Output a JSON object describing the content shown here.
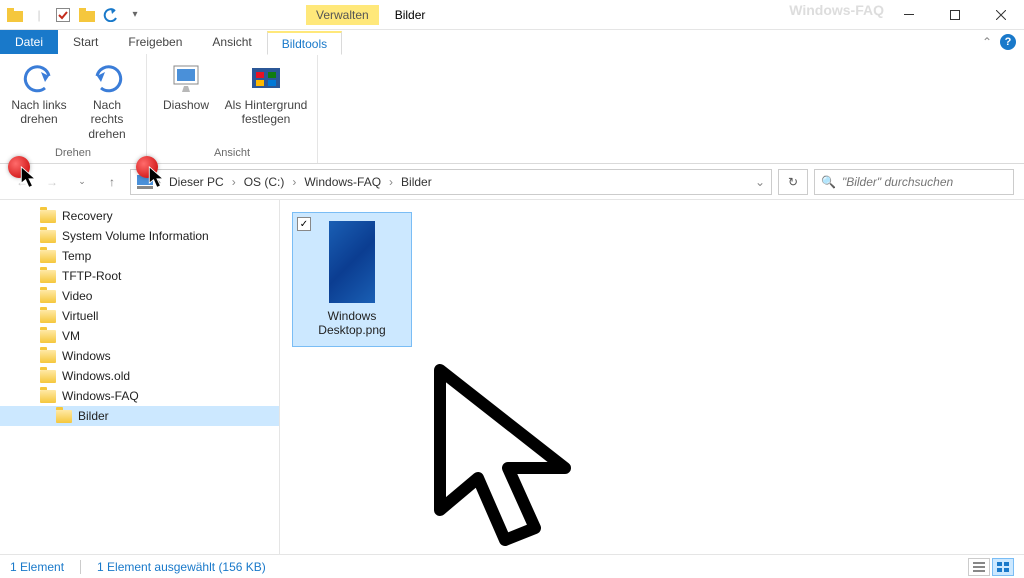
{
  "titlebar": {
    "verwalten": "Verwalten",
    "title": "Bilder",
    "watermark": "Windows-FAQ"
  },
  "tabs": {
    "datei": "Datei",
    "start": "Start",
    "freigeben": "Freigeben",
    "ansicht": "Ansicht",
    "bildtools": "Bildtools"
  },
  "ribbon": {
    "rotate_left": "Nach links drehen",
    "rotate_right": "Nach rechts drehen",
    "slideshow": "Diashow",
    "set_background": "Als Hintergrund festlegen",
    "group_drehen": "Drehen",
    "group_ansicht": "Ansicht"
  },
  "breadcrumb": {
    "root": "Dieser PC",
    "drive": "OS (C:)",
    "folder1": "Windows-FAQ",
    "folder2": "Bilder"
  },
  "search": {
    "placeholder": "\"Bilder\" durchsuchen"
  },
  "sidebar": {
    "items": [
      {
        "label": "Recovery"
      },
      {
        "label": "System Volume Information"
      },
      {
        "label": "Temp"
      },
      {
        "label": "TFTP-Root"
      },
      {
        "label": "Video"
      },
      {
        "label": "Virtuell"
      },
      {
        "label": "VM"
      },
      {
        "label": "Windows"
      },
      {
        "label": "Windows.old"
      },
      {
        "label": "Windows-FAQ"
      }
    ],
    "selected": "Bilder"
  },
  "file": {
    "name": "Windows Desktop.png"
  },
  "status": {
    "count": "1 Element",
    "selection": "1 Element ausgewählt (156 KB)"
  }
}
